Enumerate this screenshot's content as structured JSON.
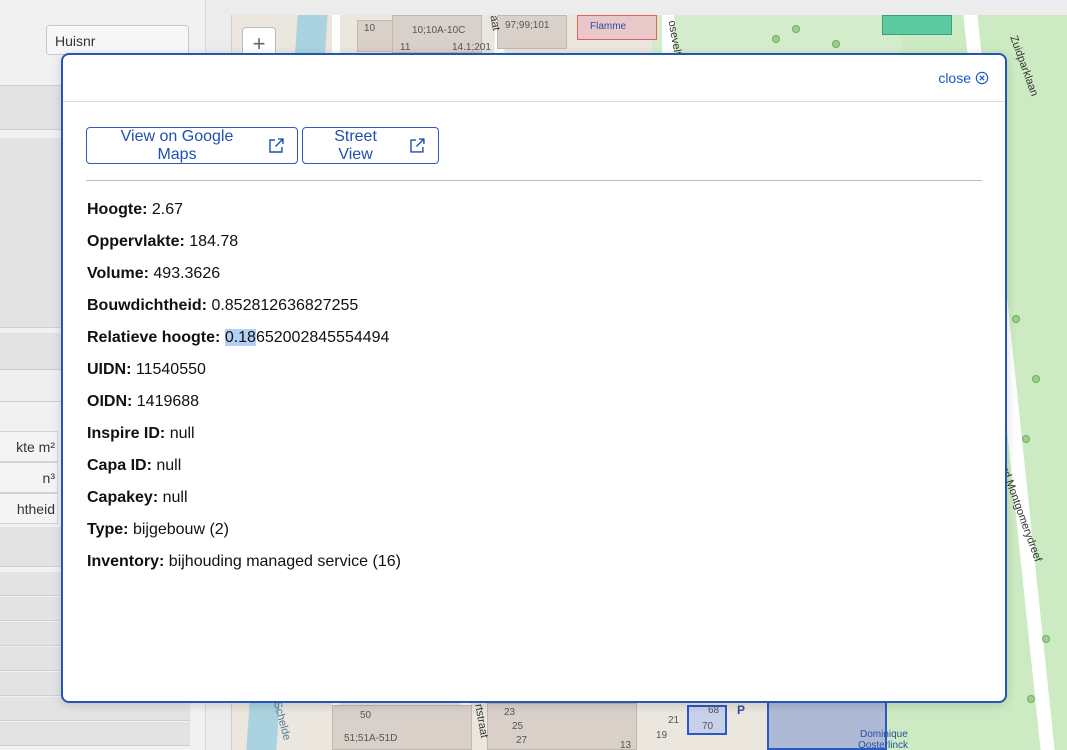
{
  "left_panel": {
    "huisnr_label": "Huisnr",
    "rows": [
      "kte m²",
      "n³",
      "htheid"
    ]
  },
  "map": {
    "zoom_in": "+",
    "labels": {
      "flamme": "Flamme",
      "zuidparklaan": "Zuidparklaan",
      "montgomery": "Bernard Montgomerydreef",
      "dominique": "Dominique",
      "oosterlinck": "Oosterlinck",
      "house_numbers_top": "97;99;101",
      "n10": "10",
      "n10a": "10;10A-10C",
      "n11": "11",
      "n14": "14.1;201",
      "n50": "50",
      "n51": "51;51A-51D",
      "n23": "23",
      "n25": "25",
      "n27": "27",
      "n21": "21",
      "n19": "19",
      "n13": "13",
      "n68": "68",
      "n70": "70",
      "schelde": "Schelde",
      "straat_top": "aat",
      "velt": "oseveltl",
      "straat_bottom": "rtstraat",
      "parking": "P"
    }
  },
  "modal": {
    "close_label": "close",
    "buttons": {
      "google_maps": "View on Google Maps",
      "street_view": "Street View"
    },
    "properties": [
      {
        "label": "Hoogte:",
        "value": "2.67"
      },
      {
        "label": "Oppervlakte:",
        "value": "184.78"
      },
      {
        "label": "Volume:",
        "value": "493.3626"
      },
      {
        "label": "Bouwdichtheid:",
        "value": "0.852812636827255"
      },
      {
        "label": "Relatieve hoogte:",
        "value_selected": "0.18",
        "value_rest": "652002845554494"
      },
      {
        "label": "UIDN:",
        "value": "11540550"
      },
      {
        "label": "OIDN:",
        "value": "1419688"
      },
      {
        "label": "Inspire ID:",
        "value": "null"
      },
      {
        "label": "Capa ID:",
        "value": "null"
      },
      {
        "label": "Capakey:",
        "value": "null"
      },
      {
        "label": "Type:",
        "value": "bijgebouw (2)"
      },
      {
        "label": "Inventory:",
        "value": "bijhouding managed service (16)"
      }
    ]
  },
  "colors": {
    "accent": "#2456b5",
    "link": "#1a56c8",
    "selection": "#b3d1f5"
  }
}
